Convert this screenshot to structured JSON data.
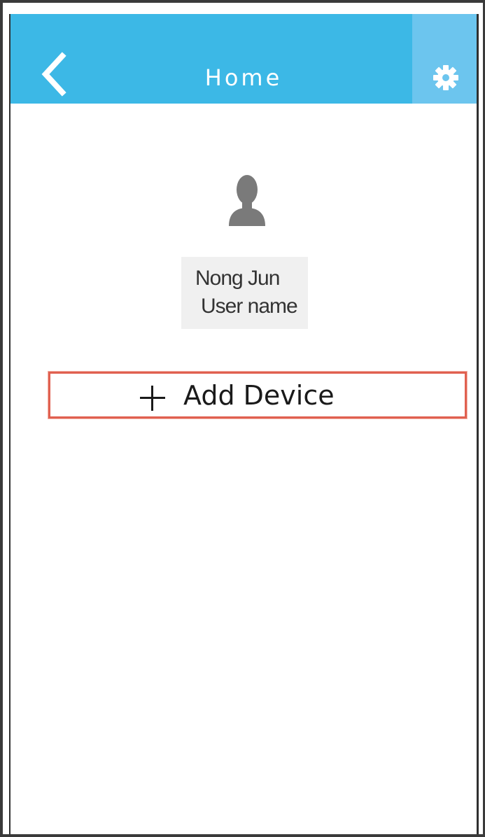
{
  "header": {
    "title": "Home",
    "back_icon": "chevron-left-icon",
    "settings_icon": "gear-icon"
  },
  "user": {
    "avatar_icon": "user-silhouette-icon",
    "name": "Nong Jun",
    "subtitle": "User name"
  },
  "actions": {
    "add_device_icon": "plus-icon",
    "add_device_label": "Add Device"
  },
  "colors": {
    "header_bg": "#3cb8e6",
    "settings_bg": "#6cc5ee",
    "highlight_border": "#e06050"
  }
}
